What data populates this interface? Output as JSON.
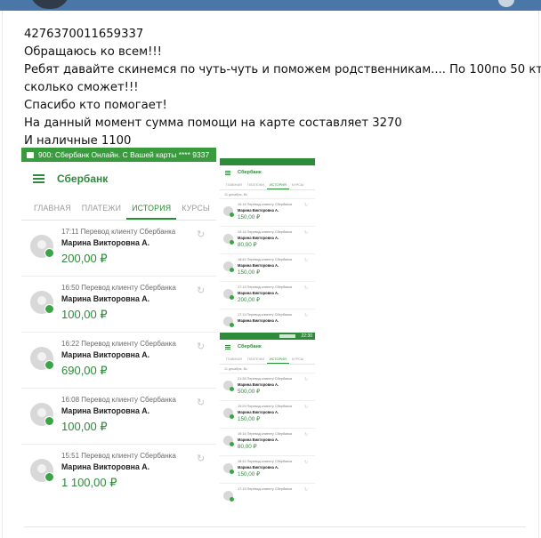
{
  "post": {
    "lines": [
      "4276370011659337",
      "Обращаюсь ко всем!!!",
      "Ребят давайте скинемся по чуть-чуть и поможем родственникам.... По 100по 50 кто",
      "сколько сможет!!!",
      "Спасибо кто помогает!",
      "На данный момент сумма помощи на карте составляет 3270",
      "И наличные 1100"
    ]
  },
  "bank_shot": {
    "notification": "900: Сбербанк Онлайн. С Вашей карты **** 9337",
    "app_title": "Сбербанк",
    "tabs": [
      "ГЛАВНАЯ",
      "ПЛАТЕЖИ",
      "ИСТОРИЯ",
      "КУРСЫ"
    ],
    "active_tab": "ИСТОРИЯ",
    "transactions": [
      {
        "meta": "17:11 Перевод клиенту Сбербанка",
        "name": "Марина Викторовна А.",
        "amount": "200,00 ₽"
      },
      {
        "meta": "16:50 Перевод клиенту Сбербанка",
        "name": "Марина Викторовна А.",
        "amount": "100,00 ₽"
      },
      {
        "meta": "16:22 Перевод клиенту Сбербанка",
        "name": "Марина Викторовна А.",
        "amount": "690,00 ₽"
      },
      {
        "meta": "16:08 Перевод клиенту Сбербанка",
        "name": "Марина Викторовна А.",
        "amount": "100,00 ₽"
      },
      {
        "meta": "15:51 Перевод клиенту Сбербанка",
        "name": "Марина Викторовна А.",
        "amount": "1 100,00 ₽"
      }
    ]
  },
  "mini_shot_a": {
    "app_title": "Сбербанк",
    "tabs": [
      "ГЛАВНАЯ",
      "ПЛАТЕЖИ",
      "ИСТОРИЯ",
      "КУРСЫ"
    ],
    "date": "11 декабря, Вс",
    "transactions": [
      {
        "meta": "19:14 Перевод клиенту Сбербанка",
        "name": "Марина Викторовна А.",
        "amount": "150,00 ₽"
      },
      {
        "meta": "19:14 Перевод клиенту Сбербанка",
        "name": "Марина Викторовна А.",
        "amount": "80,00 ₽"
      },
      {
        "meta": "18:41 Перевод клиенту Сбербанка",
        "name": "Марина Викторовна А.",
        "amount": "150,00 ₽"
      },
      {
        "meta": "17:13 Перевод клиенту Сбербанка",
        "name": "Марина Викторовна А.",
        "amount": "200,00 ₽"
      },
      {
        "meta": "17:11 Перевод клиенту Сбербанка",
        "name": "Марина Викторовна А.",
        "amount": ""
      }
    ]
  },
  "mini_shot_b": {
    "app_title": "Сбербанк",
    "clock": "22:30",
    "tabs": [
      "ГЛАВНАЯ",
      "ПЛАТЕЖИ",
      "ИСТОРИЯ",
      "КУРСЫ"
    ],
    "date": "11 декабря, Вс",
    "transactions": [
      {
        "meta": "21:28 Перевод клиенту Сбербанка",
        "name": "Марина Викторовна А.",
        "amount": "500,00 ₽"
      },
      {
        "meta": "19:29 Перевод клиенту Сбербанка",
        "name": "Марина Викторовна А.",
        "amount": "150,00 ₽"
      },
      {
        "meta": "19:14 Перевод клиенту Сбербанка",
        "name": "Марина Викторовна А.",
        "amount": "80,00 ₽"
      },
      {
        "meta": "18:41 Перевод клиенту Сбербанка",
        "name": "Марина Викторовна А.",
        "amount": "150,00 ₽"
      },
      {
        "meta": "17:13 Перевод клиенту Сбербанка",
        "name": "",
        "amount": ""
      }
    ]
  },
  "icons": {
    "menu": "hamburger-icon",
    "repeat": "repeat-icon",
    "check": "check-icon"
  },
  "colors": {
    "sber_green": "#2e8b3a",
    "vk_blue": "#4a76a8"
  }
}
